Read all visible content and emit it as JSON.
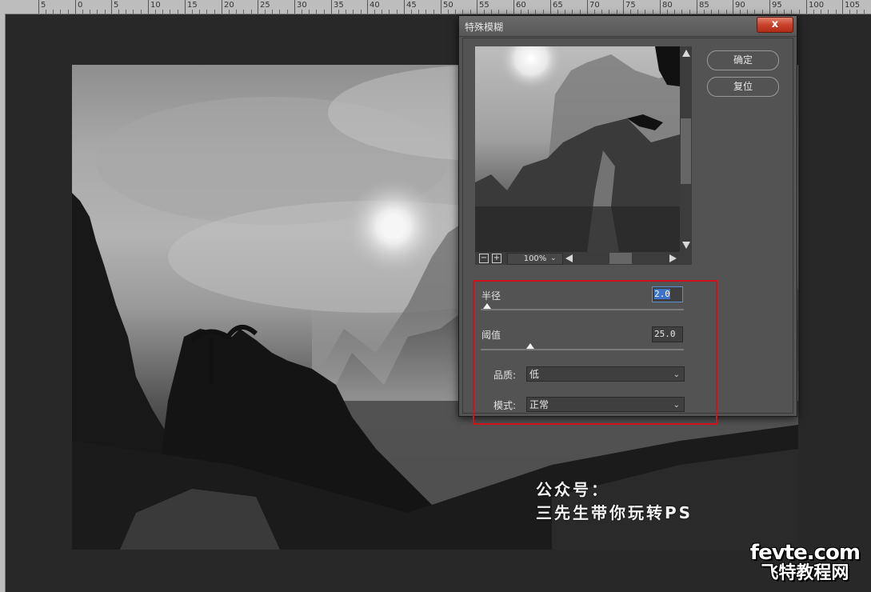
{
  "ruler": {
    "labels": [
      "5",
      "0",
      "5",
      "10",
      "15",
      "20",
      "25",
      "30",
      "35",
      "40",
      "45",
      "50",
      "55",
      "60",
      "65",
      "70",
      "75",
      "80",
      "85",
      "90",
      "95",
      "100",
      "105"
    ]
  },
  "canvas": {
    "watermark_line1": "公众号：",
    "watermark_line2": "三先生带你玩转PS",
    "site_domain": "fevte.com",
    "site_name": "飞特教程网"
  },
  "dialog": {
    "title": "特殊模糊",
    "close_label": "x",
    "ok_label": "确定",
    "reset_label": "复位",
    "preview": {
      "zoom_out": "−",
      "zoom_in": "+",
      "zoom_level": "100%"
    },
    "radius": {
      "label": "半径",
      "value": "2.0",
      "fraction": 0.03
    },
    "threshold": {
      "label": "阈值",
      "value": "25.0",
      "fraction": 0.245
    },
    "quality": {
      "label": "品质:",
      "value": "低"
    },
    "mode": {
      "label": "模式:",
      "value": "正常"
    }
  },
  "colors": {
    "highlight_box": "#d2141a",
    "close_button": "#c8412b",
    "active_input": "#3d74c9"
  }
}
